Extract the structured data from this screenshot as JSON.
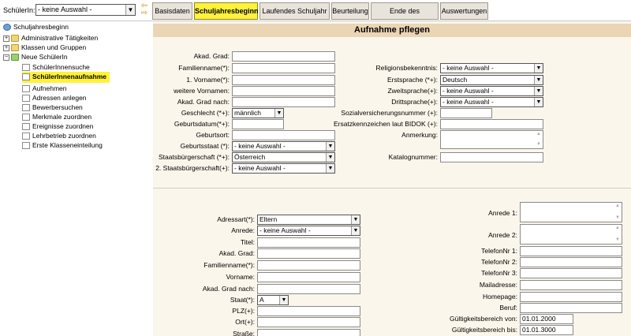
{
  "topbar": {
    "student_label": "SchülerIn:",
    "student_select": "- keine Auswahl -",
    "tabs": [
      "Basisdaten",
      "Schuljahresbeginn",
      "Laufendes Schuljahr",
      "Beurteilung",
      "Ende des Schuljahres",
      "Auswertungen"
    ],
    "active_tab": "Schuljahresbeginn"
  },
  "sidebar": {
    "root": "Schuljahresbeginn",
    "items": [
      "Administrative Tätigkeiten",
      "Klassen und Gruppen",
      "Neue SchülerIn"
    ],
    "children": [
      "SchülerInnensuche",
      "SchülerInnenaufnahme",
      "Aufnehmen",
      "Adressen anlegen",
      "Bewerbersuchen",
      "Merkmale zuordnen",
      "Ereignisse zuordnen",
      "Lehrbetrieb zuordnen",
      "Erste Klasseneinteilung"
    ]
  },
  "main": {
    "title": "Aufnahme pflegen",
    "left_labels": [
      "Akad. Grad:",
      "Familienname(*):",
      "1. Vorname(*):",
      "weitere Vornamen:",
      "Akad. Grad nach:",
      "Geschlecht (*+):",
      "Geburtsdatum(*+):",
      "Geburtsort:",
      "Geburtsstaat (*):",
      "Staatsbürgerschaft (*+):",
      "2. Staatsbürgerschaft(+):"
    ],
    "gender_value": "männlich",
    "birth_state_value": "- keine Auswahl -",
    "citizenship_value": "Österreich",
    "citizenship2_value": "- keine Auswahl -",
    "right_labels": [
      "Religionsbekenntnis:",
      "Erstsprache (*+):",
      "Zweitsprache(+):",
      "Drittsprache(+):",
      "Sozialversicherungsnummer (+):",
      "Ersatzkennzeichen laut BIDOK (+):",
      "Anmerkung:",
      "Katalognummer:"
    ],
    "religion_value": "- keine Auswahl -",
    "first_lang_value": "Deutsch",
    "second_lang_value": "- keine Auswahl -",
    "third_lang_value": "- keine Auswahl -",
    "addr_labels": [
      "Adressart(*):",
      "Anrede:",
      "Titel:",
      "Akad. Grad:",
      "Familienname(*):",
      "Vorname:",
      "Akad. Grad nach:",
      "Staat(*):",
      "PLZ(+):",
      "Ort(+):",
      "Straße:"
    ],
    "addr_type_value": "Eltern",
    "addr_salutation_value": "- keine Auswahl -",
    "addr_state_value": "A",
    "contact_labels": [
      "Anrede 1:",
      "Anrede 2:",
      "TelefonNr 1:",
      "TelefonNr 2:",
      "TelefonNr 3:",
      "Mailadresse:",
      "Homepage:",
      "Beruf:",
      "Gültigkeitsbereich von:",
      "Gültigkeitsbereich bis:"
    ],
    "valid_from": "01.01.2000",
    "valid_to": "01.01.3000"
  },
  "colors": {
    "tab_active": "#fff23a",
    "header": "#ead6b4",
    "panel": "#fbf6ec"
  }
}
